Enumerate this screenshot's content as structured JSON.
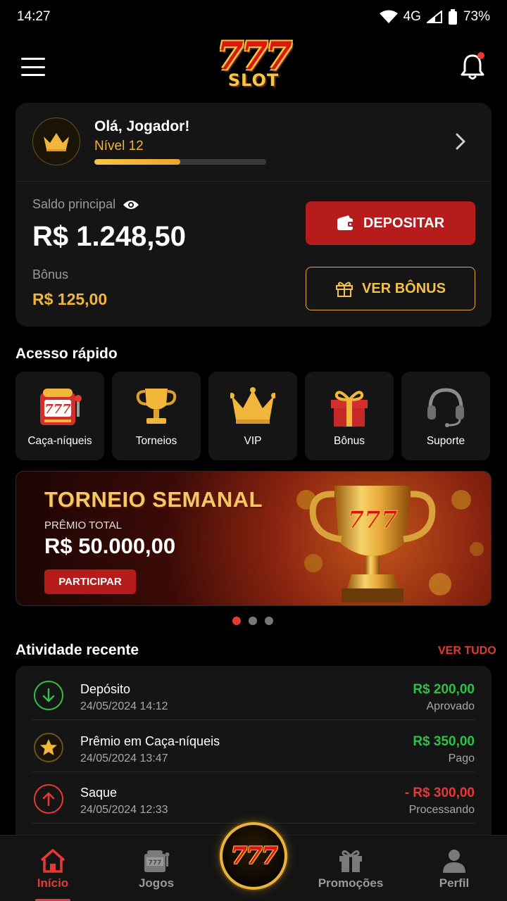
{
  "status_bar": {
    "time": "14:27",
    "network": "4G",
    "battery": "73%"
  },
  "header": {
    "logo_number": "777",
    "logo_word": "SLOT",
    "has_notification": true
  },
  "account": {
    "greeting": "Olá, Jogador!",
    "level": "Nível 12",
    "level_progress": 0.5,
    "balance_label": "Saldo principal",
    "balance": "R$ 1.248,50",
    "bonus_label": "Bônus",
    "bonus": "R$ 125,00",
    "deposit_label": "DEPOSITAR",
    "view_bonus_label": "VER BÔNUS"
  },
  "quick_access": {
    "title": "Acesso rápido",
    "items": [
      {
        "label": "Caça-níqueis",
        "icon": "slot-machine-icon"
      },
      {
        "label": "Torneios",
        "icon": "trophy-icon"
      },
      {
        "label": "VIP",
        "icon": "crown-icon"
      },
      {
        "label": "Bônus",
        "icon": "gift-icon"
      },
      {
        "label": "Suporte",
        "icon": "headset-icon"
      }
    ]
  },
  "banner": {
    "title": "TORNEIO SEMANAL",
    "subtitle": "PRÊMIO TOTAL",
    "prize": "R$ 50.000,00",
    "button": "PARTICIPAR",
    "trophy_text": "777",
    "slide_count": 3,
    "active_slide": 0
  },
  "activity": {
    "title": "Atividade recente",
    "see_all": "VER TUDO",
    "rows": [
      {
        "title": "Depósito",
        "date": "24/05/2024 14:12",
        "amount": "R$ 200,00",
        "status": "Aprovado",
        "icon": "arrow-down-icon",
        "amount_color": "#2fbf4a"
      },
      {
        "title": "Prêmio em Caça-níqueis",
        "date": "24/05/2024 13:47",
        "amount": "R$ 350,00",
        "status": "Pago",
        "icon": "star-icon",
        "amount_color": "#2fbf4a"
      },
      {
        "title": "Saque",
        "date": "24/05/2024 12:33",
        "amount": "- R$ 300,00",
        "status": "Processando",
        "icon": "arrow-up-icon",
        "amount_color": "#e53935"
      }
    ]
  },
  "nav": {
    "items": [
      {
        "label": "Início",
        "icon": "home-icon",
        "active": true
      },
      {
        "label": "Jogos",
        "icon": "slot-machine-icon",
        "active": false
      },
      {
        "label": "Promoções",
        "icon": "gift-icon",
        "active": false
      },
      {
        "label": "Perfil",
        "icon": "user-icon",
        "active": false
      }
    ],
    "center_label": "777"
  },
  "colors": {
    "accent_red": "#b71c1c",
    "gold": "#f0b53a",
    "positive": "#2fbf4a",
    "negative": "#e53935",
    "card_bg": "#151515"
  }
}
